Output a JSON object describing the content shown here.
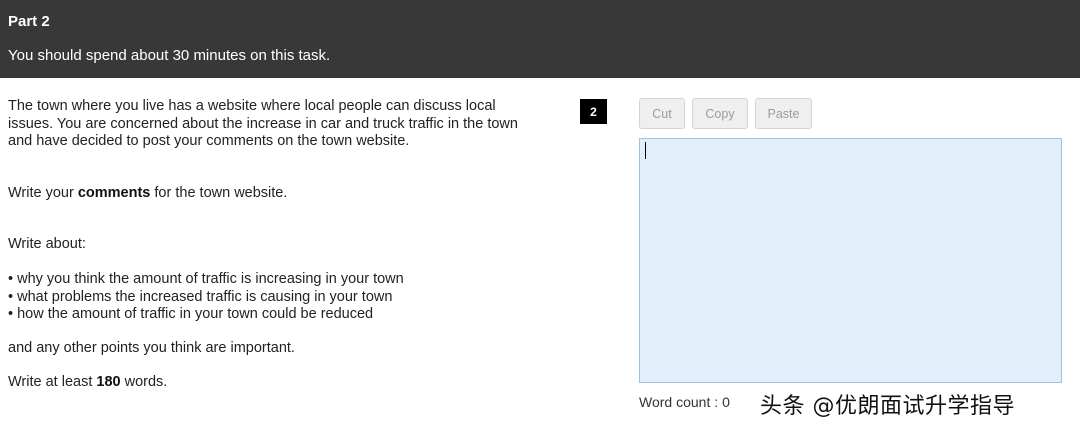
{
  "header": {
    "part_title": "Part 2",
    "instruction": "You should spend about 30 minutes on this task."
  },
  "task": {
    "intro": "The town where you live has a website where local people can discuss local issues. You are concerned about the increase in car and truck traffic in the town and have decided to post your comments on the town website.",
    "comments_pre": "Write your ",
    "comments_bold": "comments",
    "comments_post": " for the town website.",
    "write_about": "Write about:",
    "bullets": [
      "• why you think the amount of traffic is increasing in your town",
      "• what problems the increased traffic is causing in your town",
      "• how the amount of traffic in your town could be reduced"
    ],
    "other_points": "and any other points you think are important.",
    "least_pre": "Write at least ",
    "least_bold": "180",
    "least_post": " words."
  },
  "question_number": "2",
  "toolbar": {
    "cut_label": "Cut",
    "copy_label": "Copy",
    "paste_label": "Paste"
  },
  "answer": {
    "value": ""
  },
  "word_count": {
    "label": "Word count :",
    "value": "0"
  },
  "watermark": "头条 @优朗面试升学指导",
  "colors": {
    "header_bg": "#383838",
    "answer_bg": "#e3eefb",
    "answer_border": "#9fc0e6",
    "button_bg": "#efefef",
    "button_text": "#9c9c9c"
  }
}
